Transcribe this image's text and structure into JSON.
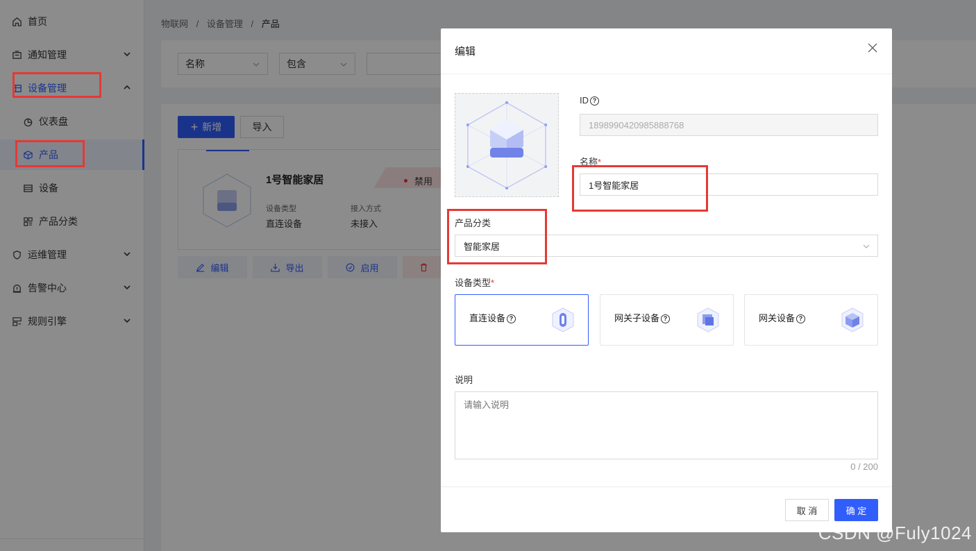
{
  "sidebar": {
    "items": [
      {
        "label": "首页",
        "icon": "home-icon"
      },
      {
        "label": "通知管理",
        "icon": "notification-icon"
      },
      {
        "label": "设备管理",
        "icon": "device-manage-icon"
      },
      {
        "label": "仪表盘",
        "icon": "dashboard-icon"
      },
      {
        "label": "产品",
        "icon": "product-cube-icon"
      },
      {
        "label": "设备",
        "icon": "device-icon"
      },
      {
        "label": "产品分类",
        "icon": "category-icon"
      },
      {
        "label": "运维管理",
        "icon": "ops-icon"
      },
      {
        "label": "告警中心",
        "icon": "alarm-icon"
      },
      {
        "label": "规则引擎",
        "icon": "rule-icon"
      }
    ]
  },
  "breadcrumb": {
    "l1": "物联网",
    "sep": "/",
    "l2": "设备管理",
    "l3": "产品"
  },
  "filter": {
    "field": "名称",
    "operator": "包含"
  },
  "toolbar": {
    "add": "新增",
    "import": "导入"
  },
  "product_card": {
    "name": "1号智能家居",
    "status": "禁用",
    "type_label": "设备类型",
    "type_value": "直连设备",
    "access_label": "接入方式",
    "access_value": "未接入"
  },
  "card_actions": {
    "edit": "编辑",
    "export": "导出",
    "enable": "启用"
  },
  "modal": {
    "title": "编辑",
    "id_label": "ID",
    "id_value": "1898990420985888768",
    "name_label": "名称",
    "name_value": "1号智能家居",
    "category_label": "产品分类",
    "category_value": "智能家居",
    "device_type_label": "设备类型",
    "device_types": [
      "直连设备",
      "网关子设备",
      "网关设备"
    ],
    "desc_label": "说明",
    "desc_placeholder": "请输入说明",
    "desc_count": "0 / 200",
    "cancel": "取 消",
    "confirm": "确 定"
  },
  "watermark": "CSDN @Fuly1024",
  "colors": {
    "primary": "#315efb",
    "highlight": "#e53935",
    "danger": "#e53935"
  }
}
